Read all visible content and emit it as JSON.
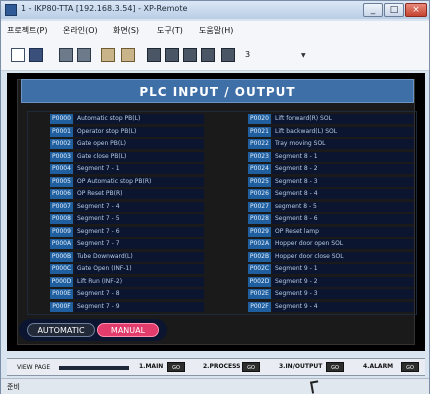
{
  "window": {
    "title": "1 - IKP80-TTA [192.168.3.54] - XP-Remote"
  },
  "menu": [
    "프로젝트(P)",
    "온라인(O)",
    "화면(S)",
    "도구(T)",
    "도움말(H)"
  ],
  "toolbar": {
    "icons": [
      "new-doc-icon",
      "save-icon",
      "device-icon",
      "device-alt-icon",
      "upload-icon",
      "download-icon",
      "tool-icon",
      "tool-icon-2",
      "tool-icon-3",
      "tool-icon-4",
      "camera-icon"
    ],
    "number": "3"
  },
  "screen": {
    "title": "PLC INPUT / OUTPUT"
  },
  "inputs": [
    {
      "code": "P0000",
      "label": "Automatic stop PB(L)"
    },
    {
      "code": "P0001",
      "label": "Operator stop PB(L)"
    },
    {
      "code": "P0002",
      "label": "Gate open PB(L)"
    },
    {
      "code": "P0003",
      "label": "Gate close PB(L)"
    },
    {
      "code": "P0004",
      "label": "Segment 7 - 1"
    },
    {
      "code": "P0005",
      "label": "OP Automatic stop PB(R)"
    },
    {
      "code": "P0006",
      "label": "OP Reset PB(R)"
    },
    {
      "code": "P0007",
      "label": "Segment 7 - 4"
    },
    {
      "code": "P0008",
      "label": "Segment 7 - 5"
    },
    {
      "code": "P0009",
      "label": "Segment 7 - 6"
    },
    {
      "code": "P000A",
      "label": "Segment 7 - 7"
    },
    {
      "code": "P000B",
      "label": "Tube Downward(L)"
    },
    {
      "code": "P000C",
      "label": "Gate Open (INF-1)"
    },
    {
      "code": "P000D",
      "label": "Lift Run (INF-2)"
    },
    {
      "code": "P000E",
      "label": "Segment 7 - 8"
    },
    {
      "code": "P000F",
      "label": "Segment 7 - 9"
    }
  ],
  "outputs": [
    {
      "code": "P0020",
      "label": "Lift forward(R) SOL"
    },
    {
      "code": "P0021",
      "label": "Lift backward(L) SOL"
    },
    {
      "code": "P0022",
      "label": "Tray moving SOL"
    },
    {
      "code": "P0023",
      "label": "Segment 8 - 1"
    },
    {
      "code": "P0024",
      "label": "Segment 8 - 2"
    },
    {
      "code": "P0025",
      "label": "Segment 8 - 3"
    },
    {
      "code": "P0026",
      "label": "Segment 8 - 4"
    },
    {
      "code": "P0027",
      "label": "segment 8 - 5"
    },
    {
      "code": "P0028",
      "label": "Segment 8 - 6"
    },
    {
      "code": "P0029",
      "label": "OP Reset lamp"
    },
    {
      "code": "P002A",
      "label": "Hopper door open SOL"
    },
    {
      "code": "P002B",
      "label": "Hopper door close SOL"
    },
    {
      "code": "P002C",
      "label": "Segment 9 - 1"
    },
    {
      "code": "P002D",
      "label": "Segment 9 - 2"
    },
    {
      "code": "P002E",
      "label": "Segment 9 - 3"
    },
    {
      "code": "P002F",
      "label": "Segment 9 - 4"
    }
  ],
  "modes": {
    "auto": "AUTOMATIC",
    "manual": "MANUAL"
  },
  "nav": {
    "view_label": "VIEW PAGE",
    "items": [
      {
        "label": "1.MAIN",
        "go": "GO"
      },
      {
        "label": "2.PROCESS",
        "go": "GO"
      },
      {
        "label": "3.IN/OUTPUT",
        "go": "GO"
      },
      {
        "label": "4.ALARM",
        "go": "GO"
      }
    ]
  },
  "status": {
    "text": "준비"
  },
  "colors": {
    "code_bg": "#1f5f9f",
    "desc_bg": "#0b1530",
    "header_bg": "#3f6fa7",
    "manual_active": "#e23c6c"
  }
}
